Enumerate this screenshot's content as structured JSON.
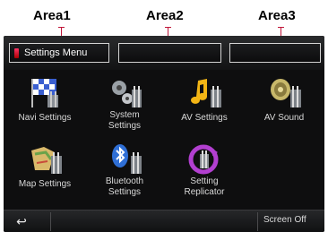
{
  "callouts": [
    "Area1",
    "Area2",
    "Area3"
  ],
  "header": {
    "title": "Settings Menu",
    "area2": "",
    "area3": ""
  },
  "tiles": [
    {
      "label": "Navi Settings",
      "icon": "navi-flag-icon"
    },
    {
      "label": "System\nSettings",
      "icon": "system-gear-icon"
    },
    {
      "label": "AV Settings",
      "icon": "av-music-note-icon"
    },
    {
      "label": "AV Sound",
      "icon": "av-speaker-icon"
    },
    {
      "label": "Map Settings",
      "icon": "map-icon"
    },
    {
      "label": "Bluetooth\nSettings",
      "icon": "bluetooth-icon"
    },
    {
      "label": "Setting\nReplicator",
      "icon": "replicator-icon"
    }
  ],
  "footer": {
    "back": "↩",
    "screen_off": "Screen Off"
  },
  "colors": {
    "callout_line": "#c0163a",
    "screen_bg": "#0e0e0f",
    "label_text": "#d9d9d9"
  }
}
